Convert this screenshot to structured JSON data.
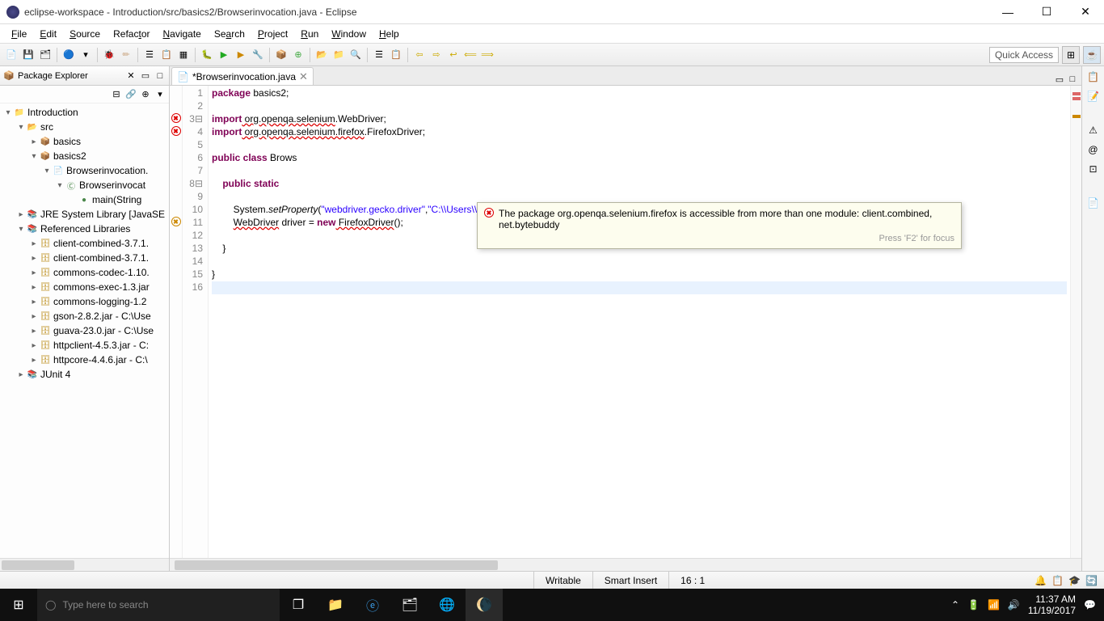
{
  "window": {
    "title": "eclipse-workspace - Introduction/src/basics2/Browserinvocation.java - Eclipse"
  },
  "menu": [
    "File",
    "Edit",
    "Source",
    "Refactor",
    "Navigate",
    "Search",
    "Project",
    "Run",
    "Window",
    "Help"
  ],
  "quick_access": "Quick Access",
  "package_explorer": {
    "title": "Package Explorer",
    "tree": {
      "project": "Introduction",
      "src": "src",
      "pkg_basics": "basics",
      "pkg_basics2": "basics2",
      "file": "Browserinvocation.",
      "class": "Browserinvocat",
      "method": "main(String",
      "jre": "JRE System Library [JavaSE",
      "reflib": "Referenced Libraries",
      "jars": [
        "client-combined-3.7.1.",
        "client-combined-3.7.1.",
        "commons-codec-1.10.",
        "commons-exec-1.3.jar",
        "commons-logging-1.2",
        "gson-2.8.2.jar - C:\\Use",
        "guava-23.0.jar - C:\\Use",
        "httpclient-4.5.3.jar - C:",
        "httpcore-4.4.6.jar - C:\\"
      ],
      "junit": "JUnit 4"
    }
  },
  "editor": {
    "tab": "*Browserinvocation.java",
    "lines": {
      "l1_package": "package",
      "l1_rest": " basics2;",
      "l3_import": "import",
      "l3_pkg": " org.openqa.selenium",
      "l3_rest": ".WebDriver;",
      "l4_import": "import",
      "l4_pkg": " org.openqa.selenium.firefox",
      "l4_rest": ".FirefoxDriver;",
      "l6_public_class": "public class",
      "l6_rest": " Brows",
      "l8_public_static": "public static",
      "l10a": "        System.",
      "l10_setprop": "setProperty",
      "l10b": "(",
      "l10_s1": "\"webdriver.gecko.driver\"",
      "l10c": ",",
      "l10_s2": "\"C:\\\\Users\\\\KAPIL\\\\Desktop\\\\Selenium\\\\JAR Files\\\\Version 3.7.1\\\\geckodriver.exe\"",
      "l10d": ");",
      "l11_wd": "WebDriver",
      "l11_mid": " driver = ",
      "l11_new": "new",
      "l11_fx": " FirefoxDriver",
      "l11_end": "();",
      "l13": "    }",
      "l15": "}"
    },
    "tooltip": {
      "text": "The package org.openqa.selenium.firefox is accessible from more than one module: client.combined, net.bytebuddy",
      "hint": "Press 'F2' for focus"
    }
  },
  "status": {
    "writable": "Writable",
    "insert": "Smart Insert",
    "pos": "16 : 1"
  },
  "taskbar": {
    "search_placeholder": "Type here to search",
    "time": "11:37 AM",
    "date": "11/19/2017"
  }
}
